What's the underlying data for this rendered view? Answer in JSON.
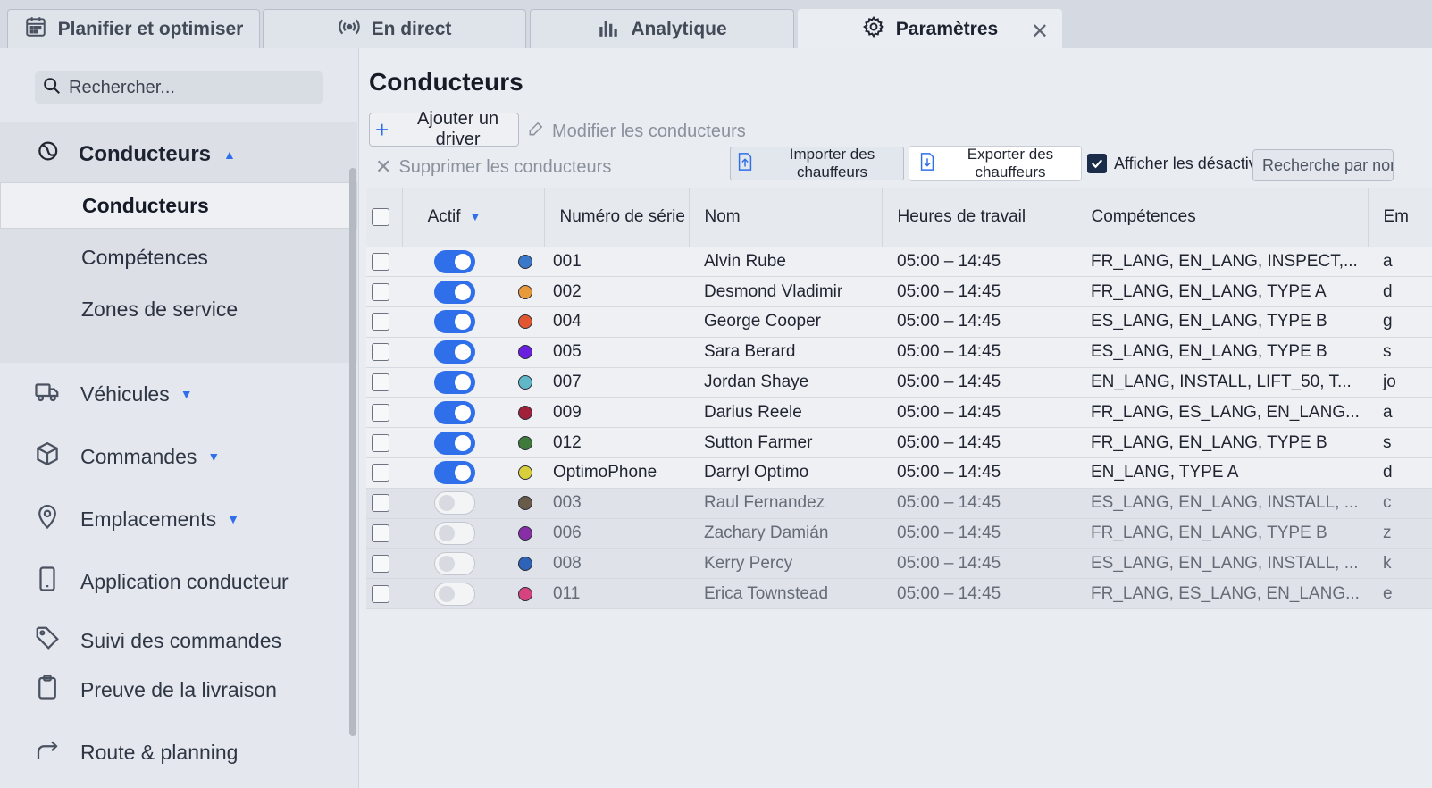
{
  "tabs": [
    {
      "label": "Planifier et optimiser",
      "icon": "calendar-icon"
    },
    {
      "label": "En direct",
      "icon": "broadcast-icon"
    },
    {
      "label": "Analytique",
      "icon": "bar-chart-icon"
    },
    {
      "label": "Paramètres",
      "icon": "gear-icon",
      "active": true
    }
  ],
  "tab_close": "✕",
  "sidebar": {
    "search_placeholder": "Rechercher...",
    "group": {
      "label": "Conducteurs",
      "items": [
        "Conducteurs",
        "Compétences",
        "Zones de service"
      ]
    },
    "items": [
      {
        "label": "Véhicules",
        "icon": "truck-icon"
      },
      {
        "label": "Commandes",
        "icon": "box-icon"
      },
      {
        "label": "Emplacements",
        "icon": "location-pin-icon"
      },
      {
        "label": "Application conducteur",
        "icon": "phone-icon"
      },
      {
        "label": "Suivi des commandes",
        "icon": "tag-icon"
      },
      {
        "label": "Preuve de la livraison",
        "icon": "clipboard-icon"
      },
      {
        "label": "Route & planning",
        "icon": "route-arrow-icon"
      }
    ]
  },
  "main": {
    "title": "Conducteurs",
    "add_driver": "Ajouter un driver",
    "edit_drivers": "Modifier les conducteurs",
    "delete_drivers": "Supprimer les conducteurs",
    "import_drivers": "Importer des chauffeurs",
    "export_drivers": "Exporter des chauffeurs",
    "show_disabled": "Afficher les désactivés",
    "name_search_placeholder": "Recherche par nom"
  },
  "table": {
    "columns": {
      "active": "Actif",
      "serial": "Numéro de série",
      "name": "Nom",
      "hours": "Heures de travail",
      "skills": "Compétences",
      "email": "Em"
    },
    "rows": [
      {
        "active": true,
        "color": "#3a78c9",
        "serial": "001",
        "name": "Alvin Rube",
        "hours": "05:00 – 14:45",
        "skills": "FR_LANG, EN_LANG, INSPECT,...",
        "email": "a"
      },
      {
        "active": true,
        "color": "#e89a3a",
        "serial": "002",
        "name": "Desmond Vladimir",
        "hours": "05:00 – 14:45",
        "skills": "FR_LANG, EN_LANG, TYPE A",
        "email": "d"
      },
      {
        "active": true,
        "color": "#e2562f",
        "serial": "004",
        "name": "George Cooper",
        "hours": "05:00 – 14:45",
        "skills": "ES_LANG, EN_LANG, TYPE B",
        "email": "g"
      },
      {
        "active": true,
        "color": "#6a1fe0",
        "serial": "005",
        "name": "Sara Berard",
        "hours": "05:00 – 14:45",
        "skills": "ES_LANG, EN_LANG, TYPE B",
        "email": "s"
      },
      {
        "active": true,
        "color": "#5fb7c7",
        "serial": "007",
        "name": "Jordan Shaye",
        "hours": "05:00 – 14:45",
        "skills": "EN_LANG, INSTALL, LIFT_50, T...",
        "email": "jo"
      },
      {
        "active": true,
        "color": "#a1203a",
        "serial": "009",
        "name": "Darius Reele",
        "hours": "05:00 – 14:45",
        "skills": "FR_LANG, ES_LANG, EN_LANG...",
        "email": "a"
      },
      {
        "active": true,
        "color": "#3f7a3a",
        "serial": "012",
        "name": "Sutton Farmer",
        "hours": "05:00 – 14:45",
        "skills": "FR_LANG, EN_LANG, TYPE B",
        "email": "s"
      },
      {
        "active": true,
        "color": "#d8cf3a",
        "serial": "OptimoPhone",
        "name": "Darryl Optimo",
        "hours": "05:00 – 14:45",
        "skills": "EN_LANG, TYPE A",
        "email": "d"
      },
      {
        "active": false,
        "color": "#6a5a48",
        "serial": "003",
        "name": "Raul Fernandez",
        "hours": "05:00 – 14:45",
        "skills": "ES_LANG, EN_LANG, INSTALL, ...",
        "email": "c"
      },
      {
        "active": false,
        "color": "#8a2ea8",
        "serial": "006",
        "name": "Zachary Damián",
        "hours": "05:00 – 14:45",
        "skills": "FR_LANG, EN_LANG, TYPE B",
        "email": "z"
      },
      {
        "active": false,
        "color": "#2e63b8",
        "serial": "008",
        "name": "Kerry Percy",
        "hours": "05:00 – 14:45",
        "skills": "ES_LANG, EN_LANG, INSTALL, ...",
        "email": "k"
      },
      {
        "active": false,
        "color": "#d6437f",
        "serial": "011",
        "name": "Erica Townstead",
        "hours": "05:00 – 14:45",
        "skills": "FR_LANG, ES_LANG, EN_LANG...",
        "email": "e"
      }
    ]
  }
}
